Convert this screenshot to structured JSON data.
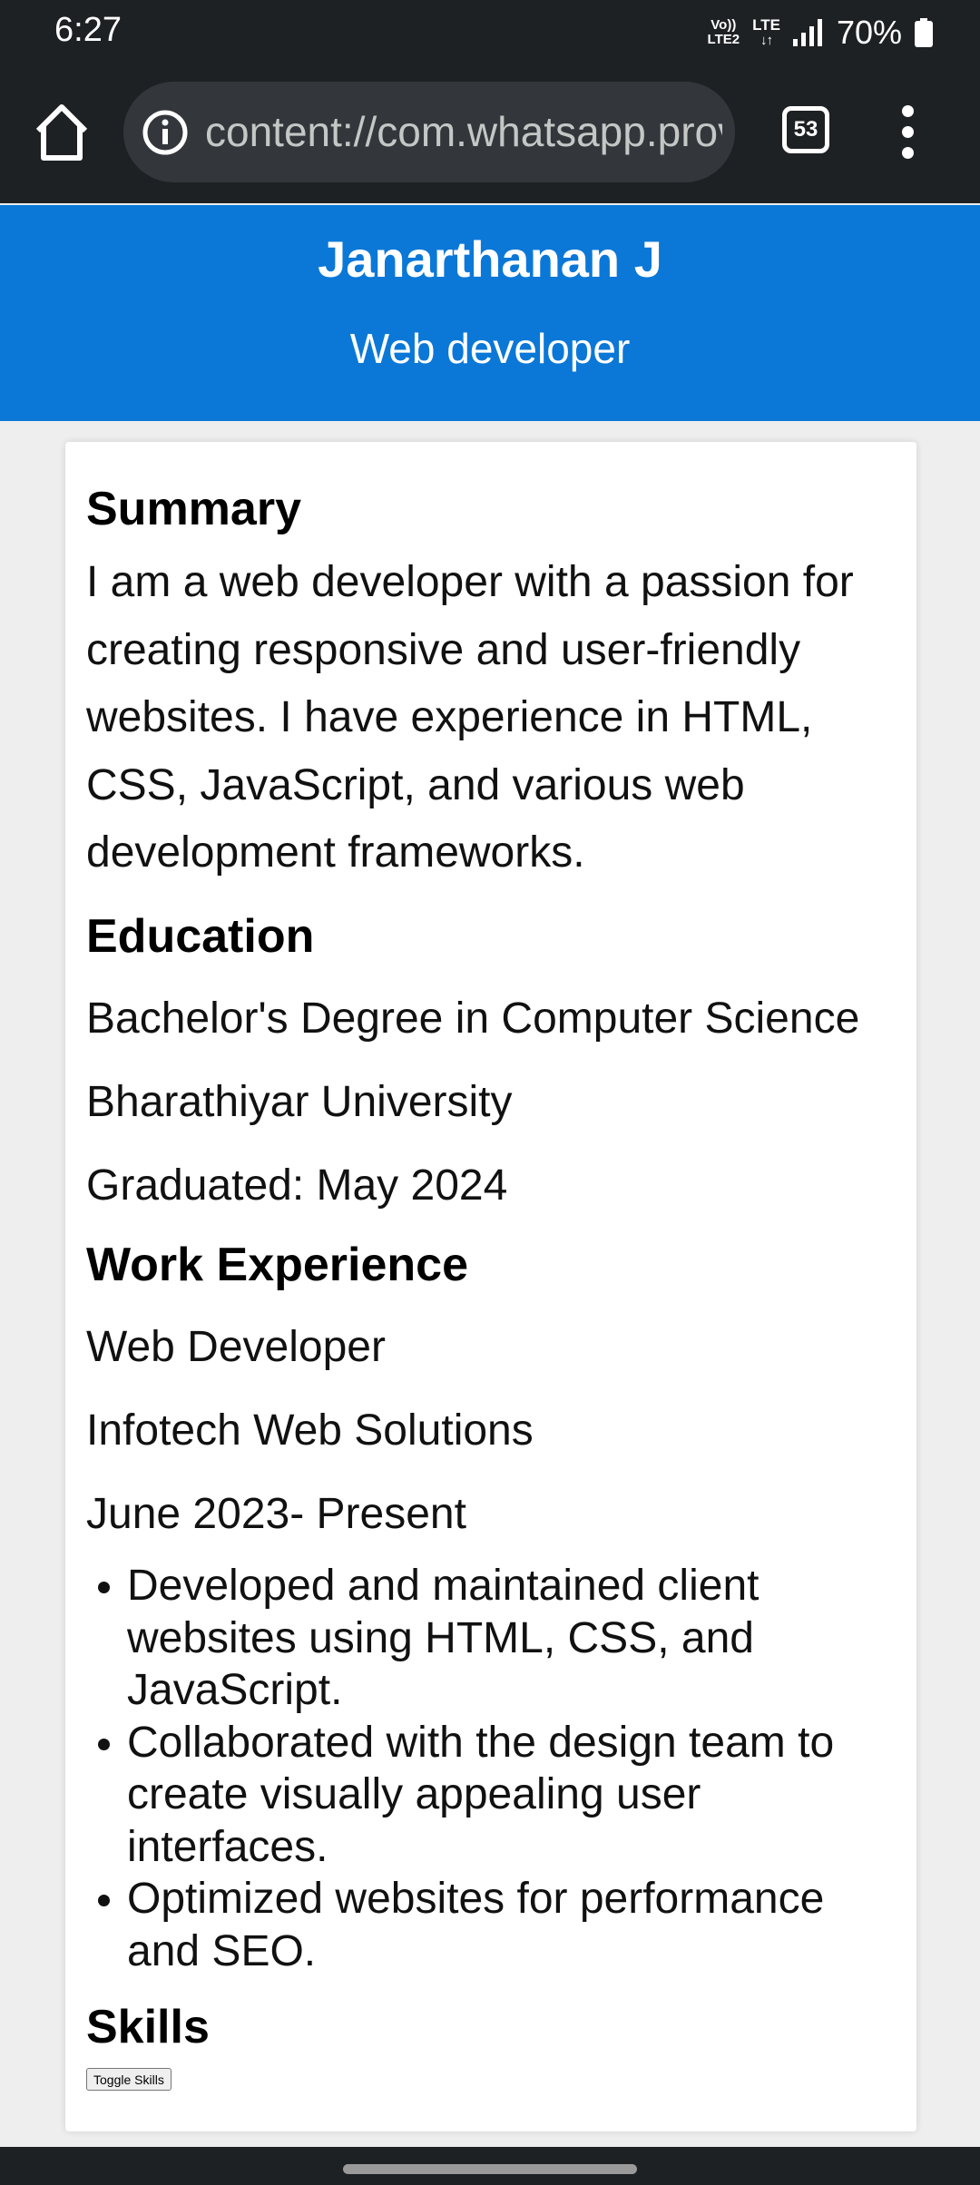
{
  "status_bar": {
    "time": "6:27",
    "volte_top": "Vo))",
    "volte_bottom": "LTE2",
    "lte_top": "LTE",
    "lte_bottom": "↓↑",
    "battery_percent": "70%"
  },
  "toolbar": {
    "url": "content://com.whatsapp.provider.media/item/",
    "tab_count": "53"
  },
  "header": {
    "name": "Janarthanan J",
    "title": "Web developer"
  },
  "summary": {
    "heading": "Summary",
    "text": "I am a web developer with a passion for creating responsive and user-friendly websites. I have experience in HTML, CSS, JavaScript, and various web development frameworks."
  },
  "education": {
    "heading": "Education",
    "degree": "Bachelor's Degree in Computer Science",
    "institution": "Bharathiyar University",
    "graduated": "Graduated: May 2024"
  },
  "experience": {
    "heading": "Work Experience",
    "role": "Web Developer",
    "company": "Infotech Web Solutions",
    "period": "June 2023- Present",
    "duties": [
      "Developed and maintained client websites using HTML, CSS, and JavaScript.",
      "Collaborated with the design team to create visually appealing user interfaces.",
      "Optimized websites for performance and SEO."
    ]
  },
  "skills": {
    "heading": "Skills",
    "toggle_label": "Toggle Skills"
  },
  "colors": {
    "header_bg": "#0b78d7",
    "chrome_bg": "#1e2124",
    "page_bg": "#eeeeee"
  }
}
